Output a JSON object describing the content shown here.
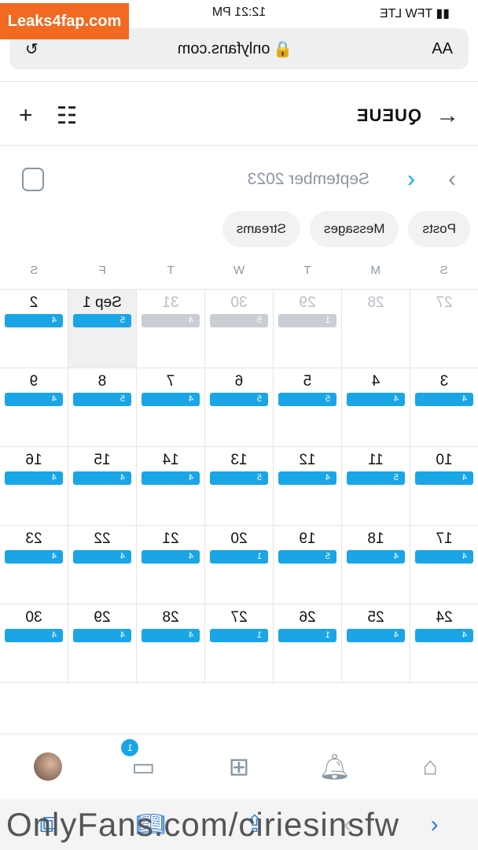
{
  "status": {
    "time": "12:21 PM",
    "carrier": "TFW",
    "network": "LTE"
  },
  "address": {
    "text_size": "AA",
    "url": "onlyfans.com"
  },
  "header": {
    "title": "QUEUE"
  },
  "calendar": {
    "month": "September 2023",
    "weekdays": [
      "S",
      "M",
      "T",
      "W",
      "T",
      "F",
      "S"
    ],
    "weeks": [
      [
        {
          "d": "27",
          "c": "",
          "o": true
        },
        {
          "d": "28",
          "c": "",
          "o": true
        },
        {
          "d": "29",
          "c": "1",
          "o": true
        },
        {
          "d": "30",
          "c": "5",
          "o": true
        },
        {
          "d": "31",
          "c": "4",
          "o": true
        },
        {
          "d": "Sep 1",
          "c": "5",
          "today": true
        },
        {
          "d": "2",
          "c": "4"
        }
      ],
      [
        {
          "d": "3",
          "c": "4"
        },
        {
          "d": "4",
          "c": "4"
        },
        {
          "d": "5",
          "c": "5"
        },
        {
          "d": "6",
          "c": "5"
        },
        {
          "d": "7",
          "c": "4"
        },
        {
          "d": "8",
          "c": "5"
        },
        {
          "d": "9",
          "c": "4"
        }
      ],
      [
        {
          "d": "10",
          "c": "4"
        },
        {
          "d": "11",
          "c": "5"
        },
        {
          "d": "12",
          "c": "4"
        },
        {
          "d": "13",
          "c": "5"
        },
        {
          "d": "14",
          "c": "4"
        },
        {
          "d": "15",
          "c": "4"
        },
        {
          "d": "16",
          "c": "4"
        }
      ],
      [
        {
          "d": "17",
          "c": "4"
        },
        {
          "d": "18",
          "c": "4"
        },
        {
          "d": "19",
          "c": "5"
        },
        {
          "d": "20",
          "c": "1"
        },
        {
          "d": "21",
          "c": "4"
        },
        {
          "d": "22",
          "c": "4"
        },
        {
          "d": "23",
          "c": "4"
        }
      ],
      [
        {
          "d": "24",
          "c": "4"
        },
        {
          "d": "25",
          "c": "4"
        },
        {
          "d": "26",
          "c": "1"
        },
        {
          "d": "27",
          "c": "1"
        },
        {
          "d": "28",
          "c": "4"
        },
        {
          "d": "29",
          "c": "4"
        },
        {
          "d": "30",
          "c": "4"
        }
      ]
    ]
  },
  "filters": [
    "Posts",
    "Messages",
    "Streams"
  ],
  "nav": {
    "messages_badge": "1"
  },
  "colors": {
    "accent": "#1aa5e6",
    "muted": "#8a96a3"
  },
  "watermarks": {
    "top": "Leaks4fap.com",
    "bottom": "OnlyFans.com/ciriesinsfw"
  }
}
